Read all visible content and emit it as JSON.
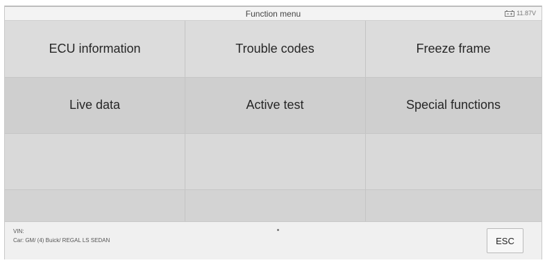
{
  "header": {
    "title": "Function menu",
    "battery_voltage": "11.87V",
    "battery_icon": "battery-icon"
  },
  "menu": {
    "items": [
      {
        "label": "ECU information"
      },
      {
        "label": "Trouble codes"
      },
      {
        "label": "Freeze frame"
      },
      {
        "label": "Live data"
      },
      {
        "label": "Active test"
      },
      {
        "label": "Special functions"
      }
    ]
  },
  "footer": {
    "vin_label": "VIN:",
    "car_info": "Car: GM/ (4) Buick/ REGAL LS SEDAN",
    "esc_label": "ESC"
  }
}
